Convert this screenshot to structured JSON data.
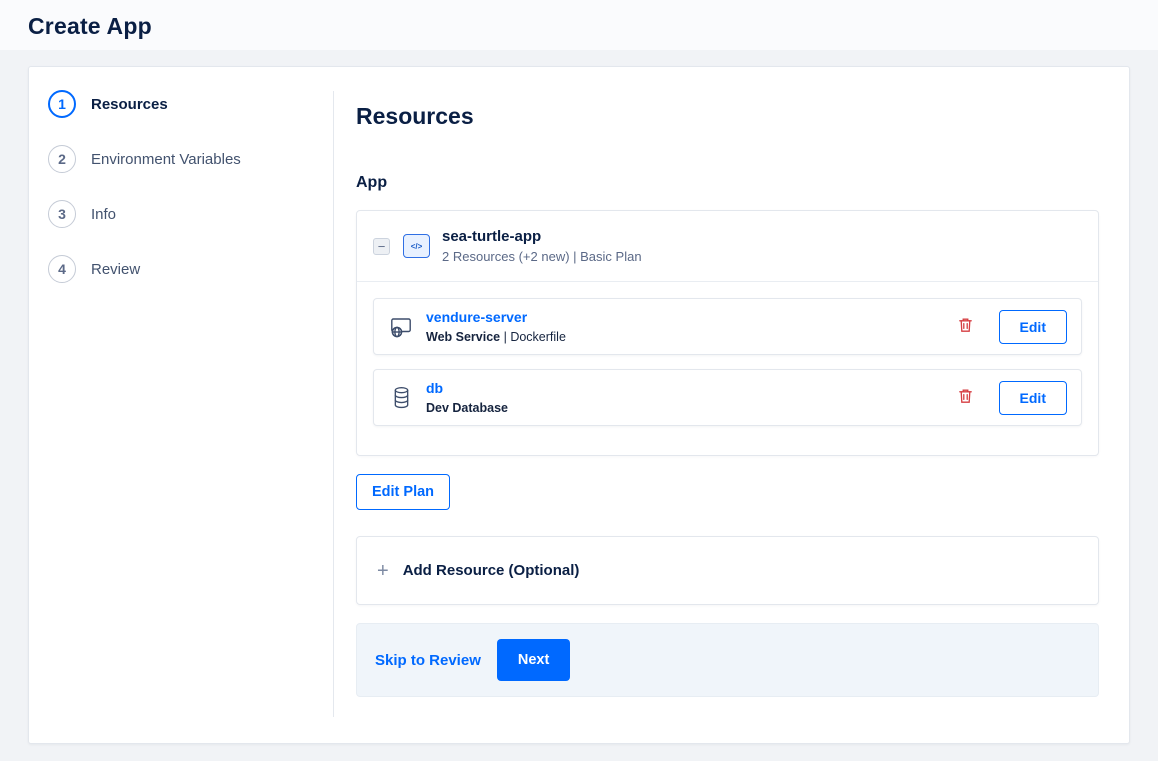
{
  "page": {
    "title": "Create App"
  },
  "stepper": {
    "steps": [
      {
        "number": "1",
        "label": "Resources"
      },
      {
        "number": "2",
        "label": "Environment Variables"
      },
      {
        "number": "3",
        "label": "Info"
      },
      {
        "number": "4",
        "label": "Review"
      }
    ]
  },
  "content": {
    "heading": "Resources",
    "section_label": "App",
    "app_group": {
      "collapse_glyph": "−",
      "icon_glyph": "</>",
      "name": "sea-turtle-app",
      "summary": "2 Resources (+2 new) | Basic Plan",
      "resources": [
        {
          "name": "vendure-server",
          "type": "Web Service",
          "detail_suffix": " | Dockerfile",
          "edit_label": "Edit"
        },
        {
          "name": "db",
          "type": "Dev Database",
          "detail_suffix": "",
          "edit_label": "Edit"
        }
      ]
    },
    "edit_plan_label": "Edit Plan",
    "add_resource": {
      "plus_glyph": "+",
      "label": "Add Resource (Optional)"
    },
    "footer": {
      "skip_label": "Skip to Review",
      "next_label": "Next"
    }
  },
  "colors": {
    "accent_blue": "#0069ff",
    "dark_navy": "#0a1f44",
    "muted_gray": "#5b6987",
    "danger_red": "#d63e42",
    "page_background": "#f1f3f6"
  }
}
